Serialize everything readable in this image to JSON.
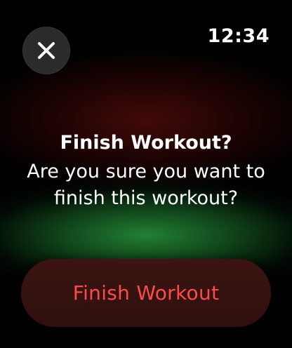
{
  "status_bar": {
    "time": "12:34"
  },
  "close_button": {
    "icon": "close-icon"
  },
  "dialog": {
    "title": "Finish Workout?",
    "message": "Are you sure you want to finish this workout?"
  },
  "actions": {
    "finish_label": "Finish Workout"
  },
  "colors": {
    "background": "#000000",
    "close_button_bg": "#2b2b2b",
    "finish_button_bg": "#3a1411",
    "finish_label": "#ff4a4a",
    "glow_green": "#2a8c3c",
    "glow_red": "#78120e"
  }
}
